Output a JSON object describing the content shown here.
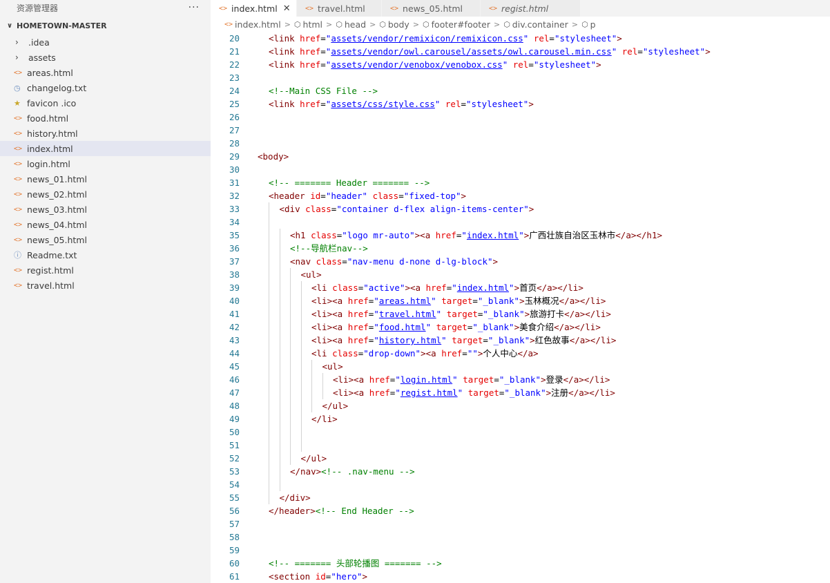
{
  "explorer": {
    "title": "资源管理器",
    "more": "···",
    "folder": "HOMETOWN-MASTER",
    "items": [
      {
        "label": ".idea",
        "icon": "chevron-right-icon"
      },
      {
        "label": "assets",
        "icon": "chevron-right-icon"
      },
      {
        "label": "areas.html",
        "icon": "html-file-icon"
      },
      {
        "label": "changelog.txt",
        "icon": "clock-file-icon"
      },
      {
        "label": "favicon .ico",
        "icon": "star-file-icon"
      },
      {
        "label": "food.html",
        "icon": "html-file-icon"
      },
      {
        "label": "history.html",
        "icon": "html-file-icon"
      },
      {
        "label": "index.html",
        "icon": "html-file-icon"
      },
      {
        "label": "login.html",
        "icon": "html-file-icon"
      },
      {
        "label": "news_01.html",
        "icon": "html-file-icon"
      },
      {
        "label": "news_02.html",
        "icon": "html-file-icon"
      },
      {
        "label": "news_03.html",
        "icon": "html-file-icon"
      },
      {
        "label": "news_04.html",
        "icon": "html-file-icon"
      },
      {
        "label": "news_05.html",
        "icon": "html-file-icon"
      },
      {
        "label": "Readme.txt",
        "icon": "info-file-icon"
      },
      {
        "label": "regist.html",
        "icon": "html-file-icon"
      },
      {
        "label": "travel.html",
        "icon": "html-file-icon"
      }
    ],
    "active_item": "index.html"
  },
  "tabs": [
    {
      "label": "index.html",
      "close": "✕"
    },
    {
      "label": "travel.html"
    },
    {
      "label": "news_05.html"
    },
    {
      "label": "regist.html"
    }
  ],
  "breadcrumb": [
    "index.html",
    "html",
    "head",
    "body",
    "footer#footer",
    "div.container",
    "p"
  ],
  "colors": {
    "tag": "#800000",
    "attribute": "#e50000",
    "value": "#0000ff",
    "comment": "#008000",
    "line_number": "#237893",
    "active_row": "#e4e6f1"
  },
  "code": [
    {
      "n": "20",
      "indent": 1,
      "tokens": [
        [
          "tag",
          "<link "
        ],
        [
          "attr",
          "href"
        ],
        [
          "txt",
          "="
        ],
        [
          "val",
          "\""
        ],
        [
          "link",
          "assets/vendor/remixicon/remixicon.css"
        ],
        [
          "val",
          "\""
        ],
        [
          "txt",
          " "
        ],
        [
          "attr",
          "rel"
        ],
        [
          "txt",
          "="
        ],
        [
          "val",
          "\"stylesheet\""
        ],
        [
          "tag",
          ">"
        ]
      ]
    },
    {
      "n": "21",
      "indent": 1,
      "tokens": [
        [
          "tag",
          "<link "
        ],
        [
          "attr",
          "href"
        ],
        [
          "txt",
          "="
        ],
        [
          "val",
          "\""
        ],
        [
          "link",
          "assets/vendor/owl.carousel/assets/owl.carousel.min.css"
        ],
        [
          "val",
          "\""
        ],
        [
          "txt",
          " "
        ],
        [
          "attr",
          "rel"
        ],
        [
          "txt",
          "="
        ],
        [
          "val",
          "\"stylesheet\""
        ],
        [
          "tag",
          ">"
        ]
      ]
    },
    {
      "n": "22",
      "indent": 1,
      "tokens": [
        [
          "tag",
          "<link "
        ],
        [
          "attr",
          "href"
        ],
        [
          "txt",
          "="
        ],
        [
          "val",
          "\""
        ],
        [
          "link",
          "assets/vendor/venobox/venobox.css"
        ],
        [
          "val",
          "\""
        ],
        [
          "txt",
          " "
        ],
        [
          "attr",
          "rel"
        ],
        [
          "txt",
          "="
        ],
        [
          "val",
          "\"stylesheet\""
        ],
        [
          "tag",
          ">"
        ]
      ]
    },
    {
      "n": "23",
      "indent": 1,
      "tokens": []
    },
    {
      "n": "24",
      "indent": 1,
      "tokens": [
        [
          "com",
          "<!--Main CSS File -->"
        ]
      ]
    },
    {
      "n": "25",
      "indent": 1,
      "tokens": [
        [
          "tag",
          "<link "
        ],
        [
          "attr",
          "href"
        ],
        [
          "txt",
          "="
        ],
        [
          "val",
          "\""
        ],
        [
          "link",
          "assets/css/style.css"
        ],
        [
          "val",
          "\""
        ],
        [
          "txt",
          " "
        ],
        [
          "attr",
          "rel"
        ],
        [
          "txt",
          "="
        ],
        [
          "val",
          "\"stylesheet\""
        ],
        [
          "tag",
          ">"
        ]
      ]
    },
    {
      "n": "26",
      "indent": 0,
      "tokens": []
    },
    {
      "n": "27",
      "indent": 0,
      "tokens": []
    },
    {
      "n": "28",
      "indent": 0,
      "tokens": []
    },
    {
      "n": "29",
      "indent": 0,
      "tokens": [
        [
          "tag",
          "<body>"
        ]
      ]
    },
    {
      "n": "30",
      "indent": 0,
      "tokens": []
    },
    {
      "n": "31",
      "indent": 1,
      "tokens": [
        [
          "com",
          "<!-- ======= Header ======= -->"
        ]
      ]
    },
    {
      "n": "32",
      "indent": 1,
      "tokens": [
        [
          "tag",
          "<header "
        ],
        [
          "attr",
          "id"
        ],
        [
          "txt",
          "="
        ],
        [
          "val",
          "\"header\""
        ],
        [
          "txt",
          " "
        ],
        [
          "attr",
          "class"
        ],
        [
          "txt",
          "="
        ],
        [
          "val",
          "\"fixed-top\""
        ],
        [
          "tag",
          ">"
        ]
      ]
    },
    {
      "n": "33",
      "indent": 2,
      "tokens": [
        [
          "tag",
          "<div "
        ],
        [
          "attr",
          "class"
        ],
        [
          "txt",
          "="
        ],
        [
          "val",
          "\"container d-flex align-items-center\""
        ],
        [
          "tag",
          ">"
        ]
      ]
    },
    {
      "n": "34",
      "indent": 2,
      "tokens": []
    },
    {
      "n": "35",
      "indent": 3,
      "tokens": [
        [
          "tag",
          "<h1 "
        ],
        [
          "attr",
          "class"
        ],
        [
          "txt",
          "="
        ],
        [
          "val",
          "\"logo mr-auto\""
        ],
        [
          "tag",
          "><a "
        ],
        [
          "attr",
          "href"
        ],
        [
          "txt",
          "="
        ],
        [
          "val",
          "\""
        ],
        [
          "link",
          "index.html"
        ],
        [
          "val",
          "\""
        ],
        [
          "tag",
          ">"
        ],
        [
          "txt",
          "广西壮族自治区玉林市"
        ],
        [
          "tag",
          "</a></h1>"
        ]
      ]
    },
    {
      "n": "36",
      "indent": 3,
      "tokens": [
        [
          "com",
          "<!--导航栏nav-->"
        ]
      ]
    },
    {
      "n": "37",
      "indent": 3,
      "tokens": [
        [
          "tag",
          "<nav "
        ],
        [
          "attr",
          "class"
        ],
        [
          "txt",
          "="
        ],
        [
          "val",
          "\"nav-menu d-none d-lg-block\""
        ],
        [
          "tag",
          ">"
        ]
      ]
    },
    {
      "n": "38",
      "indent": 4,
      "tokens": [
        [
          "tag",
          "<ul>"
        ]
      ]
    },
    {
      "n": "39",
      "indent": 5,
      "tokens": [
        [
          "tag",
          "<li "
        ],
        [
          "attr",
          "class"
        ],
        [
          "txt",
          "="
        ],
        [
          "val",
          "\"active\""
        ],
        [
          "tag",
          "><a "
        ],
        [
          "attr",
          "href"
        ],
        [
          "txt",
          "="
        ],
        [
          "val",
          "\""
        ],
        [
          "link",
          "index.html"
        ],
        [
          "val",
          "\""
        ],
        [
          "tag",
          ">"
        ],
        [
          "txt",
          "首页"
        ],
        [
          "tag",
          "</a></li>"
        ]
      ]
    },
    {
      "n": "40",
      "indent": 5,
      "tokens": [
        [
          "tag",
          "<li><a "
        ],
        [
          "attr",
          "href"
        ],
        [
          "txt",
          "="
        ],
        [
          "val",
          "\""
        ],
        [
          "link",
          "areas.html"
        ],
        [
          "val",
          "\""
        ],
        [
          "txt",
          " "
        ],
        [
          "attr",
          "target"
        ],
        [
          "txt",
          "="
        ],
        [
          "val",
          "\"_blank\""
        ],
        [
          "tag",
          ">"
        ],
        [
          "txt",
          "玉林概况"
        ],
        [
          "tag",
          "</a></li>"
        ]
      ]
    },
    {
      "n": "41",
      "indent": 5,
      "tokens": [
        [
          "tag",
          "<li><a "
        ],
        [
          "attr",
          "href"
        ],
        [
          "txt",
          "="
        ],
        [
          "val",
          "\""
        ],
        [
          "link",
          "travel.html"
        ],
        [
          "val",
          "\""
        ],
        [
          "txt",
          " "
        ],
        [
          "attr",
          "target"
        ],
        [
          "txt",
          "="
        ],
        [
          "val",
          "\"_blank\""
        ],
        [
          "tag",
          ">"
        ],
        [
          "txt",
          "旅游打卡"
        ],
        [
          "tag",
          "</a></li>"
        ]
      ]
    },
    {
      "n": "42",
      "indent": 5,
      "tokens": [
        [
          "tag",
          "<li><a "
        ],
        [
          "attr",
          "href"
        ],
        [
          "txt",
          "="
        ],
        [
          "val",
          "\""
        ],
        [
          "link",
          "food.html"
        ],
        [
          "val",
          "\""
        ],
        [
          "txt",
          " "
        ],
        [
          "attr",
          "target"
        ],
        [
          "txt",
          "="
        ],
        [
          "val",
          "\"_blank\""
        ],
        [
          "tag",
          ">"
        ],
        [
          "txt",
          "美食介绍"
        ],
        [
          "tag",
          "</a></li>"
        ]
      ]
    },
    {
      "n": "43",
      "indent": 5,
      "tokens": [
        [
          "tag",
          "<li><a "
        ],
        [
          "attr",
          "href"
        ],
        [
          "txt",
          "="
        ],
        [
          "val",
          "\""
        ],
        [
          "link",
          "history.html"
        ],
        [
          "val",
          "\""
        ],
        [
          "txt",
          " "
        ],
        [
          "attr",
          "target"
        ],
        [
          "txt",
          "="
        ],
        [
          "val",
          "\"_blank\""
        ],
        [
          "tag",
          ">"
        ],
        [
          "txt",
          "红色故事"
        ],
        [
          "tag",
          "</a></li>"
        ]
      ]
    },
    {
      "n": "44",
      "indent": 5,
      "tokens": [
        [
          "tag",
          "<li "
        ],
        [
          "attr",
          "class"
        ],
        [
          "txt",
          "="
        ],
        [
          "val",
          "\"drop-down\""
        ],
        [
          "tag",
          "><a "
        ],
        [
          "attr",
          "href"
        ],
        [
          "txt",
          "="
        ],
        [
          "val",
          "\"\""
        ],
        [
          "tag",
          ">"
        ],
        [
          "txt",
          "个人中心"
        ],
        [
          "tag",
          "</a>"
        ]
      ]
    },
    {
      "n": "45",
      "indent": 6,
      "tokens": [
        [
          "tag",
          "<ul>"
        ]
      ]
    },
    {
      "n": "46",
      "indent": 7,
      "tokens": [
        [
          "tag",
          "<li><a "
        ],
        [
          "attr",
          "href"
        ],
        [
          "txt",
          "="
        ],
        [
          "val",
          "\""
        ],
        [
          "link",
          "login.html"
        ],
        [
          "val",
          "\""
        ],
        [
          "txt",
          " "
        ],
        [
          "attr",
          "target"
        ],
        [
          "txt",
          "="
        ],
        [
          "val",
          "\"_blank\""
        ],
        [
          "tag",
          ">"
        ],
        [
          "txt",
          "登录"
        ],
        [
          "tag",
          "</a></li>"
        ]
      ]
    },
    {
      "n": "47",
      "indent": 7,
      "tokens": [
        [
          "tag",
          "<li><a "
        ],
        [
          "attr",
          "href"
        ],
        [
          "txt",
          "="
        ],
        [
          "val",
          "\""
        ],
        [
          "link",
          "regist.html"
        ],
        [
          "val",
          "\""
        ],
        [
          "txt",
          " "
        ],
        [
          "attr",
          "target"
        ],
        [
          "txt",
          "="
        ],
        [
          "val",
          "\"_blank\""
        ],
        [
          "tag",
          ">"
        ],
        [
          "txt",
          "注册"
        ],
        [
          "tag",
          "</a></li>"
        ]
      ]
    },
    {
      "n": "48",
      "indent": 6,
      "tokens": [
        [
          "tag",
          "</ul>"
        ]
      ]
    },
    {
      "n": "49",
      "indent": 5,
      "tokens": [
        [
          "tag",
          "</li>"
        ]
      ]
    },
    {
      "n": "50",
      "indent": 5,
      "tokens": []
    },
    {
      "n": "51",
      "indent": 5,
      "tokens": []
    },
    {
      "n": "52",
      "indent": 4,
      "tokens": [
        [
          "tag",
          "</ul>"
        ]
      ]
    },
    {
      "n": "53",
      "indent": 3,
      "tokens": [
        [
          "tag",
          "</nav>"
        ],
        [
          "com",
          "<!-- .nav-menu -->"
        ]
      ]
    },
    {
      "n": "54",
      "indent": 3,
      "tokens": []
    },
    {
      "n": "55",
      "indent": 2,
      "tokens": [
        [
          "tag",
          "</div>"
        ]
      ]
    },
    {
      "n": "56",
      "indent": 1,
      "tokens": [
        [
          "tag",
          "</header>"
        ],
        [
          "com",
          "<!-- End Header -->"
        ]
      ]
    },
    {
      "n": "57",
      "indent": 1,
      "tokens": []
    },
    {
      "n": "58",
      "indent": 1,
      "tokens": []
    },
    {
      "n": "59",
      "indent": 1,
      "tokens": []
    },
    {
      "n": "60",
      "indent": 1,
      "tokens": [
        [
          "com",
          "<!-- ======= 头部轮播图 ======= -->"
        ]
      ]
    },
    {
      "n": "61",
      "indent": 1,
      "tokens": [
        [
          "tag",
          "<section "
        ],
        [
          "attr",
          "id"
        ],
        [
          "txt",
          "="
        ],
        [
          "val",
          "\"hero\""
        ],
        [
          "tag",
          ">"
        ]
      ]
    }
  ]
}
